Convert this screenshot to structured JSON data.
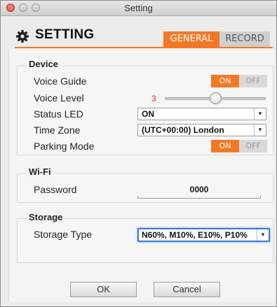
{
  "window": {
    "title": "Setting"
  },
  "header": {
    "title": "SETTING",
    "icon": "gear-icon"
  },
  "tabs": [
    {
      "label": "GENERAL",
      "active": true
    },
    {
      "label": "RECORD",
      "active": false
    }
  ],
  "device": {
    "title": "Device",
    "voice_guide": {
      "label": "Voice Guide",
      "on": "ON",
      "off": "OFF",
      "state": "on"
    },
    "voice_level": {
      "label": "Voice Level",
      "value": "3",
      "min": 0,
      "max": 5
    },
    "status_led": {
      "label": "Status LED",
      "value": "ON"
    },
    "time_zone": {
      "label": "Time Zone",
      "value": "(UTC+00:00) London"
    },
    "parking_mode": {
      "label": "Parking Mode",
      "on": "ON",
      "off": "OFF",
      "state": "on"
    }
  },
  "wifi": {
    "title": "Wi-Fi",
    "password": {
      "label": "Password",
      "value": "0000"
    }
  },
  "storage": {
    "title": "Storage",
    "storage_type": {
      "label": "Storage Type",
      "value": "N60%, M10%, E10%, P10%"
    }
  },
  "buttons": {
    "ok": "OK",
    "cancel": "Cancel"
  },
  "colors": {
    "accent": "#f37826",
    "focus": "#3b7ad9",
    "value_red": "#e2231a"
  }
}
